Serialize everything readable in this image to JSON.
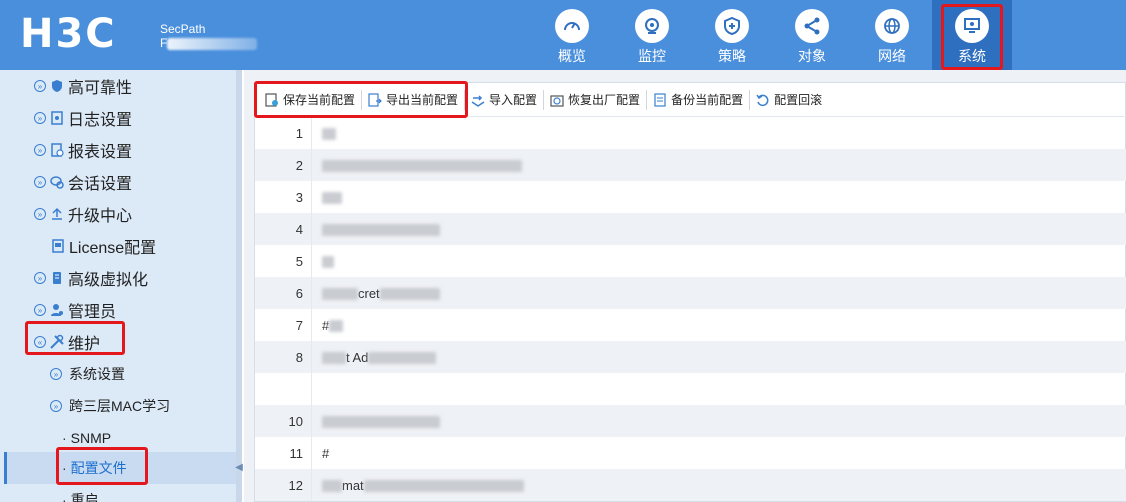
{
  "header": {
    "logo": "H3C",
    "product_line1": "SecPath",
    "product_line2": "F"
  },
  "nav": [
    {
      "label": "概览",
      "icon": "gauge-icon"
    },
    {
      "label": "监控",
      "icon": "camera-icon"
    },
    {
      "label": "策略",
      "icon": "shield-icon"
    },
    {
      "label": "对象",
      "icon": "share-icon"
    },
    {
      "label": "网络",
      "icon": "globe-icon"
    },
    {
      "label": "系统",
      "icon": "monitor-icon",
      "active": true
    }
  ],
  "sidebar": {
    "items": [
      {
        "label": "高可靠性",
        "icon": "shield-icon"
      },
      {
        "label": "日志设置",
        "icon": "log-icon"
      },
      {
        "label": "报表设置",
        "icon": "report-icon"
      },
      {
        "label": "会话设置",
        "icon": "session-icon"
      },
      {
        "label": "升级中心",
        "icon": "upload-icon"
      },
      {
        "label": "License配置",
        "icon": "license-icon"
      },
      {
        "label": "高级虚拟化",
        "icon": "virtualization-icon"
      },
      {
        "label": "管理员",
        "icon": "admin-icon"
      },
      {
        "label": "维护",
        "icon": "tools-icon",
        "expanded": true
      }
    ],
    "sub_items": [
      {
        "label": "系统设置"
      },
      {
        "label": "跨三层MAC学习"
      }
    ],
    "leaf_items": [
      {
        "label": "SNMP"
      },
      {
        "label": "配置文件",
        "current": true
      },
      {
        "label": "重启"
      }
    ]
  },
  "toolbar": {
    "save_current": "保存当前配置",
    "export_current": "导出当前配置",
    "import": "导入配置",
    "factory_reset": "恢复出厂配置",
    "backup_current": "备份当前配置",
    "rollback": "配置回滚"
  },
  "config_lines": [
    {
      "num": "1",
      "text": ""
    },
    {
      "num": "2",
      "text": ""
    },
    {
      "num": "3",
      "text": ""
    },
    {
      "num": "4",
      "text": ""
    },
    {
      "num": "5",
      "text": ""
    },
    {
      "num": "6",
      "text": "cret"
    },
    {
      "num": "7",
      "text": "#"
    },
    {
      "num": "8",
      "text": "t Ad"
    },
    {
      "num": "",
      "text": ""
    },
    {
      "num": "10",
      "text": ""
    },
    {
      "num": "11",
      "text": "#"
    },
    {
      "num": "12",
      "text": "mat"
    }
  ],
  "colors": {
    "header_bg": "#4a8fdc",
    "active_nav": "#2f6fc0",
    "sidebar_bg": "#dce9f7",
    "highlight_red": "#e4181c",
    "link_blue": "#1d6fd0"
  }
}
